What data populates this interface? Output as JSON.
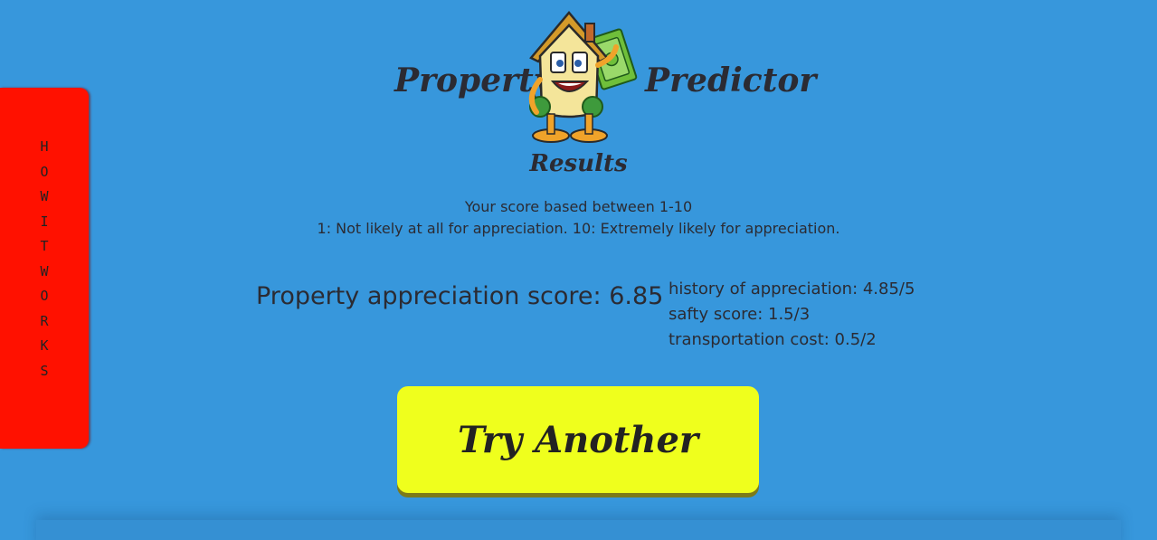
{
  "header": {
    "title_left": "Property",
    "title_right": "Predictor",
    "mascot_icon": "house-mascot-holding-money-icon"
  },
  "side_tab": {
    "label": "HOW IT WORKS"
  },
  "results": {
    "title": "Results",
    "scale_line_1": "Your score based between 1-10",
    "scale_line_2": "1: Not likely at all for appreciation. 10: Extremely likely for appreciation.",
    "main_score": "Property appreciation score: 6.85",
    "breakdown": [
      "history of appreciation: 4.85/5",
      "safty score: 1.5/3",
      "transportation cost: 0.5/2"
    ]
  },
  "actions": {
    "try_another_label": "Try Another"
  },
  "colors": {
    "background": "#3797dc",
    "side_tab": "#ff1100",
    "button": "#efff1d",
    "text": "#2b2b33"
  }
}
